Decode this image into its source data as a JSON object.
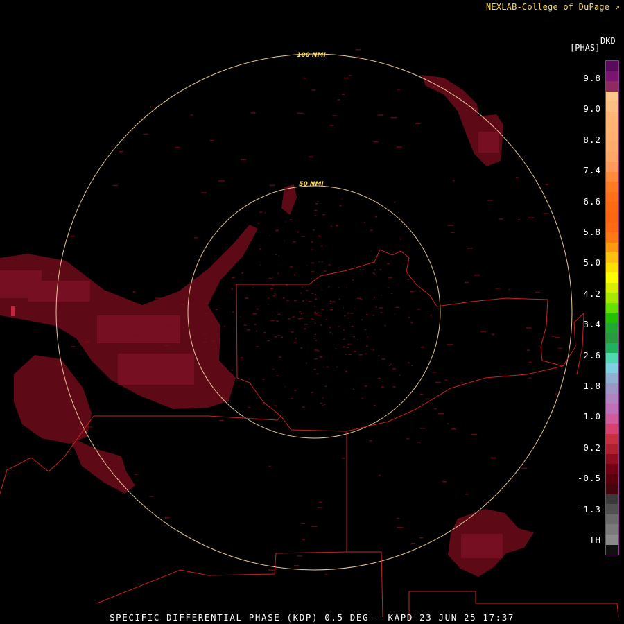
{
  "header": {
    "credit": "NEXLAB-College of DuPage ↗"
  },
  "legend": {
    "code": "DKD",
    "units": "[PHAS]",
    "labels": [
      "9.8",
      "9.0",
      "8.2",
      "7.4",
      "6.6",
      "5.8",
      "5.0",
      "4.2",
      "3.4",
      "2.6",
      "1.8",
      "1.0",
      "0.2",
      "-0.5",
      "-1.3",
      "TH"
    ],
    "colors": [
      "#5a0a5a",
      "#7a1470",
      "#8e2a5e",
      "#ffc68a",
      "#ffbf82",
      "#ffb675",
      "#ffb272",
      "#ffb070",
      "#ffab6b",
      "#ffa566",
      "#ff9a5a",
      "#ff8a3a",
      "#ff7a20",
      "#ff7018",
      "#ff6a10",
      "#ff6610",
      "#ff6a12",
      "#ff7a14",
      "#ff9a10",
      "#ffc010",
      "#ffe000",
      "#ffff00",
      "#d8f000",
      "#a8e800",
      "#66e000",
      "#22c000",
      "#20a830",
      "#2a9a40",
      "#20b060",
      "#50d8b0",
      "#7fd0e0",
      "#8fb0d0",
      "#9b98c8",
      "#b084c0",
      "#c070b8",
      "#d05a9a",
      "#d84070",
      "#c83040",
      "#b02030",
      "#900d1f",
      "#700012",
      "#5a000a",
      "#46040c",
      "#3a3a3a",
      "#505050",
      "#6a6a6a",
      "#7a7a7a",
      "#8a8a8a",
      "#101010"
    ]
  },
  "rings": {
    "inner_label": "50 NMI",
    "outer_label": "100 NMI"
  },
  "footer": {
    "text": "SPECIFIC DIFFERENTIAL PHASE (KDP) 0.5 DEG - KAPD 23 JUN 25 17:37"
  }
}
